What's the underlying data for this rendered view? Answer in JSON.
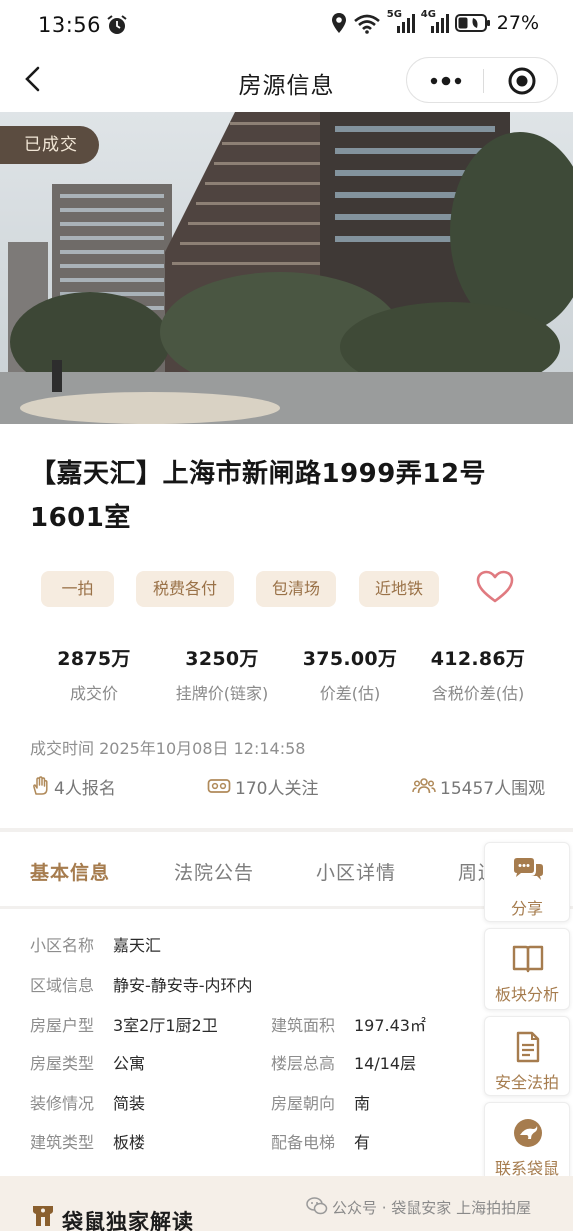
{
  "status_bar": {
    "time": "13:56",
    "battery": "27%",
    "network_labels": [
      "5G",
      "4G"
    ]
  },
  "nav": {
    "title": "房源信息"
  },
  "hero": {
    "badge": "已成交"
  },
  "listing": {
    "title_line1": "【嘉天汇】上海市新闸路1999弄12号",
    "title_line2": "1601室",
    "tags": [
      "一拍",
      "税费各付",
      "包清场",
      "近地铁"
    ]
  },
  "stats": [
    {
      "value": "2875万",
      "label": "成交价"
    },
    {
      "value": "3250万",
      "label": "挂牌价(链家)"
    },
    {
      "value": "375.00万",
      "label": "价差(估)"
    },
    {
      "value": "412.86万",
      "label": "含税价差(估)"
    }
  ],
  "deal_time": "成交时间 2025年10月08日 12:14:58",
  "meta": {
    "signups": "4人报名",
    "followers": "170人关注",
    "viewers": "15457人围观"
  },
  "tabs": [
    "基本信息",
    "法院公告",
    "小区详情",
    "周边"
  ],
  "basic_info": {
    "community_label": "小区名称",
    "community": "嘉天汇",
    "area_label": "区域信息",
    "area": "静安-静安寺-内环内",
    "layout_label": "房屋户型",
    "layout": "3室2厅1厨2卫",
    "build_area_label": "建筑面积",
    "build_area": "197.43㎡",
    "house_type_label": "房屋类型",
    "house_type": "公寓",
    "floors_label": "楼层总高",
    "floors": "14/14层",
    "decoration_label": "装修情况",
    "decoration": "简装",
    "orientation_label": "房屋朝向",
    "orientation": "南",
    "structure_label": "建筑类型",
    "structure": "板楼",
    "elevator_label": "配备电梯",
    "elevator": "有"
  },
  "side_actions": [
    "分享",
    "板块分析",
    "安全法拍",
    "联系袋鼠"
  ],
  "footer": {
    "section_title": "袋鼠独家解读",
    "watermark": "公众号 · 袋鼠安家 上海拍拍屋"
  },
  "colors": {
    "accent": "#a67c4e",
    "tag_bg": "#f6ece0",
    "badge_bg": "#5b4c40",
    "favorite": "#e07a80"
  }
}
